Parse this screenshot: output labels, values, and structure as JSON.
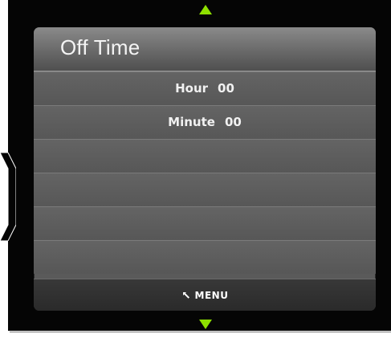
{
  "screen": {
    "title": "Off Time",
    "rows": [
      {
        "label": "Hour",
        "value": "00"
      },
      {
        "label": "Minute",
        "value": "00"
      }
    ],
    "menu": {
      "label": "MENU",
      "icon": "return-arrow-icon"
    },
    "nav": {
      "up_icon": "triangle-up-icon",
      "down_icon": "triangle-down-icon",
      "left_icon": "chevron-left-icon"
    }
  },
  "colors": {
    "panel": "#5a5a5a",
    "title_bar": "#6f6f6f",
    "menu_bar": "#2f2f2f",
    "arrow": "#8ee000",
    "frame": "#050505",
    "text": "#f1f1f1"
  }
}
